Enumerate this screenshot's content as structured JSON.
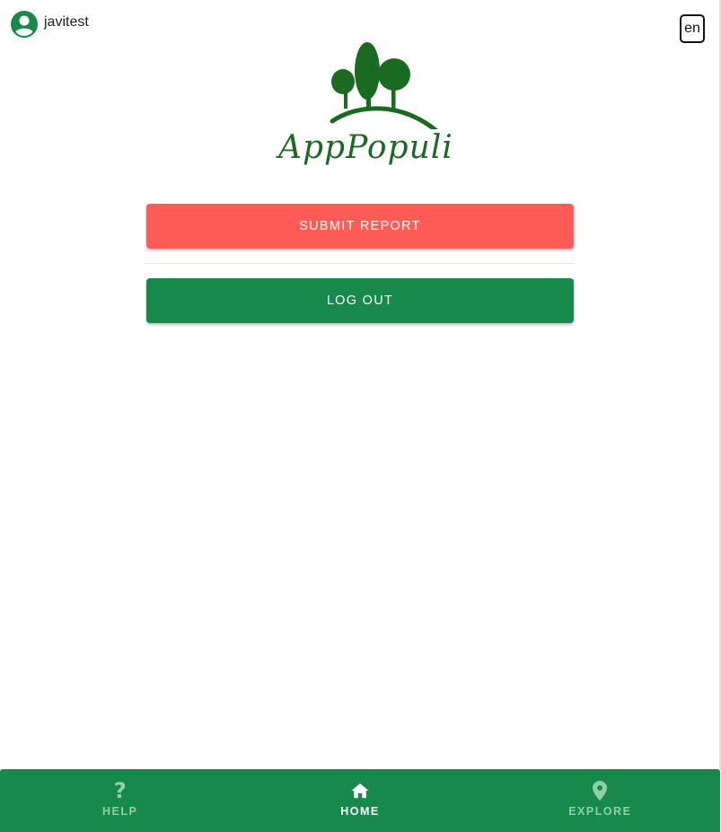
{
  "user": {
    "username": "javitest",
    "avatar_icon": "account-circle-icon"
  },
  "language": {
    "current": "en"
  },
  "logo": {
    "wordmark": "AppPopuli"
  },
  "actions": {
    "submit_report_label": "SUBMIT REPORT",
    "logout_label": "LOG OUT"
  },
  "bottom_nav": {
    "items": [
      {
        "label": "HELP",
        "icon": "help-icon",
        "active": false
      },
      {
        "label": "HOME",
        "icon": "home-icon",
        "active": true
      },
      {
        "label": "EXPLORE",
        "icon": "location-pin-icon",
        "active": false
      }
    ]
  },
  "colors": {
    "primary_green": "#178a4b",
    "submit_red": "#ff5c58",
    "logo_green": "#1a6b21",
    "nav_inactive": "#8fd0a8"
  }
}
